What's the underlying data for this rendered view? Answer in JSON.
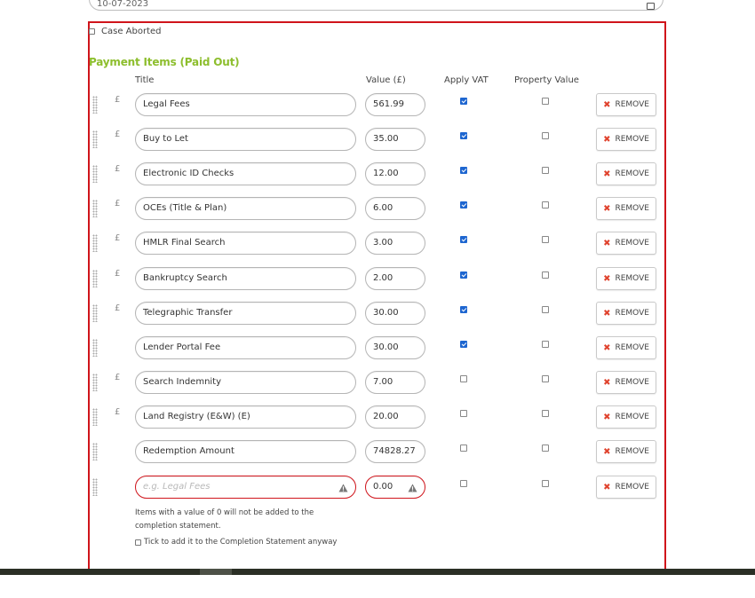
{
  "top_date": {
    "value": "10-07-2023"
  },
  "case_aborted": {
    "label": "Case Aborted",
    "checked": false
  },
  "section": {
    "title": "Payment Items (Paid Out)"
  },
  "columns": {
    "title": "Title",
    "value": "Value (£)",
    "apply_vat": "Apply VAT",
    "property_value": "Property Value"
  },
  "currency_symbol": "£",
  "remove_label": "REMOVE",
  "items": [
    {
      "title": "Legal Fees",
      "value": "561.99",
      "apply_vat": true,
      "property_value": false,
      "show_pound": true
    },
    {
      "title": "Buy to Let",
      "value": "35.00",
      "apply_vat": true,
      "property_value": false,
      "show_pound": true
    },
    {
      "title": "Electronic ID Checks",
      "value": "12.00",
      "apply_vat": true,
      "property_value": false,
      "show_pound": true
    },
    {
      "title": "OCEs (Title & Plan)",
      "value": "6.00",
      "apply_vat": true,
      "property_value": false,
      "show_pound": true
    },
    {
      "title": "HMLR Final Search",
      "value": "3.00",
      "apply_vat": true,
      "property_value": false,
      "show_pound": true
    },
    {
      "title": "Bankruptcy Search",
      "value": "2.00",
      "apply_vat": true,
      "property_value": false,
      "show_pound": true
    },
    {
      "title": "Telegraphic Transfer",
      "value": "30.00",
      "apply_vat": true,
      "property_value": false,
      "show_pound": true
    },
    {
      "title": "Lender Portal Fee",
      "value": "30.00",
      "apply_vat": true,
      "property_value": false,
      "show_pound": false
    },
    {
      "title": "Search Indemnity",
      "value": "7.00",
      "apply_vat": false,
      "property_value": false,
      "show_pound": true
    },
    {
      "title": "Land Registry (E&W) (E)",
      "value": "20.00",
      "apply_vat": false,
      "property_value": false,
      "show_pound": true
    },
    {
      "title": "Redemption Amount",
      "value": "74828.27",
      "apply_vat": false,
      "property_value": false,
      "show_pound": false
    }
  ],
  "new_item": {
    "placeholder": "e.g. Legal Fees",
    "value": "0.00",
    "apply_vat": false,
    "property_value": false
  },
  "help_text": "Items with a value of 0 will not be added to the completion statement.",
  "tick_label": "Tick to add it to the Completion Statement anyway",
  "colors": {
    "accent_green": "#8dbe2d",
    "error_red": "#d0141b",
    "checkbox_blue": "#1e66d0",
    "remove_x": "#e0442f"
  }
}
